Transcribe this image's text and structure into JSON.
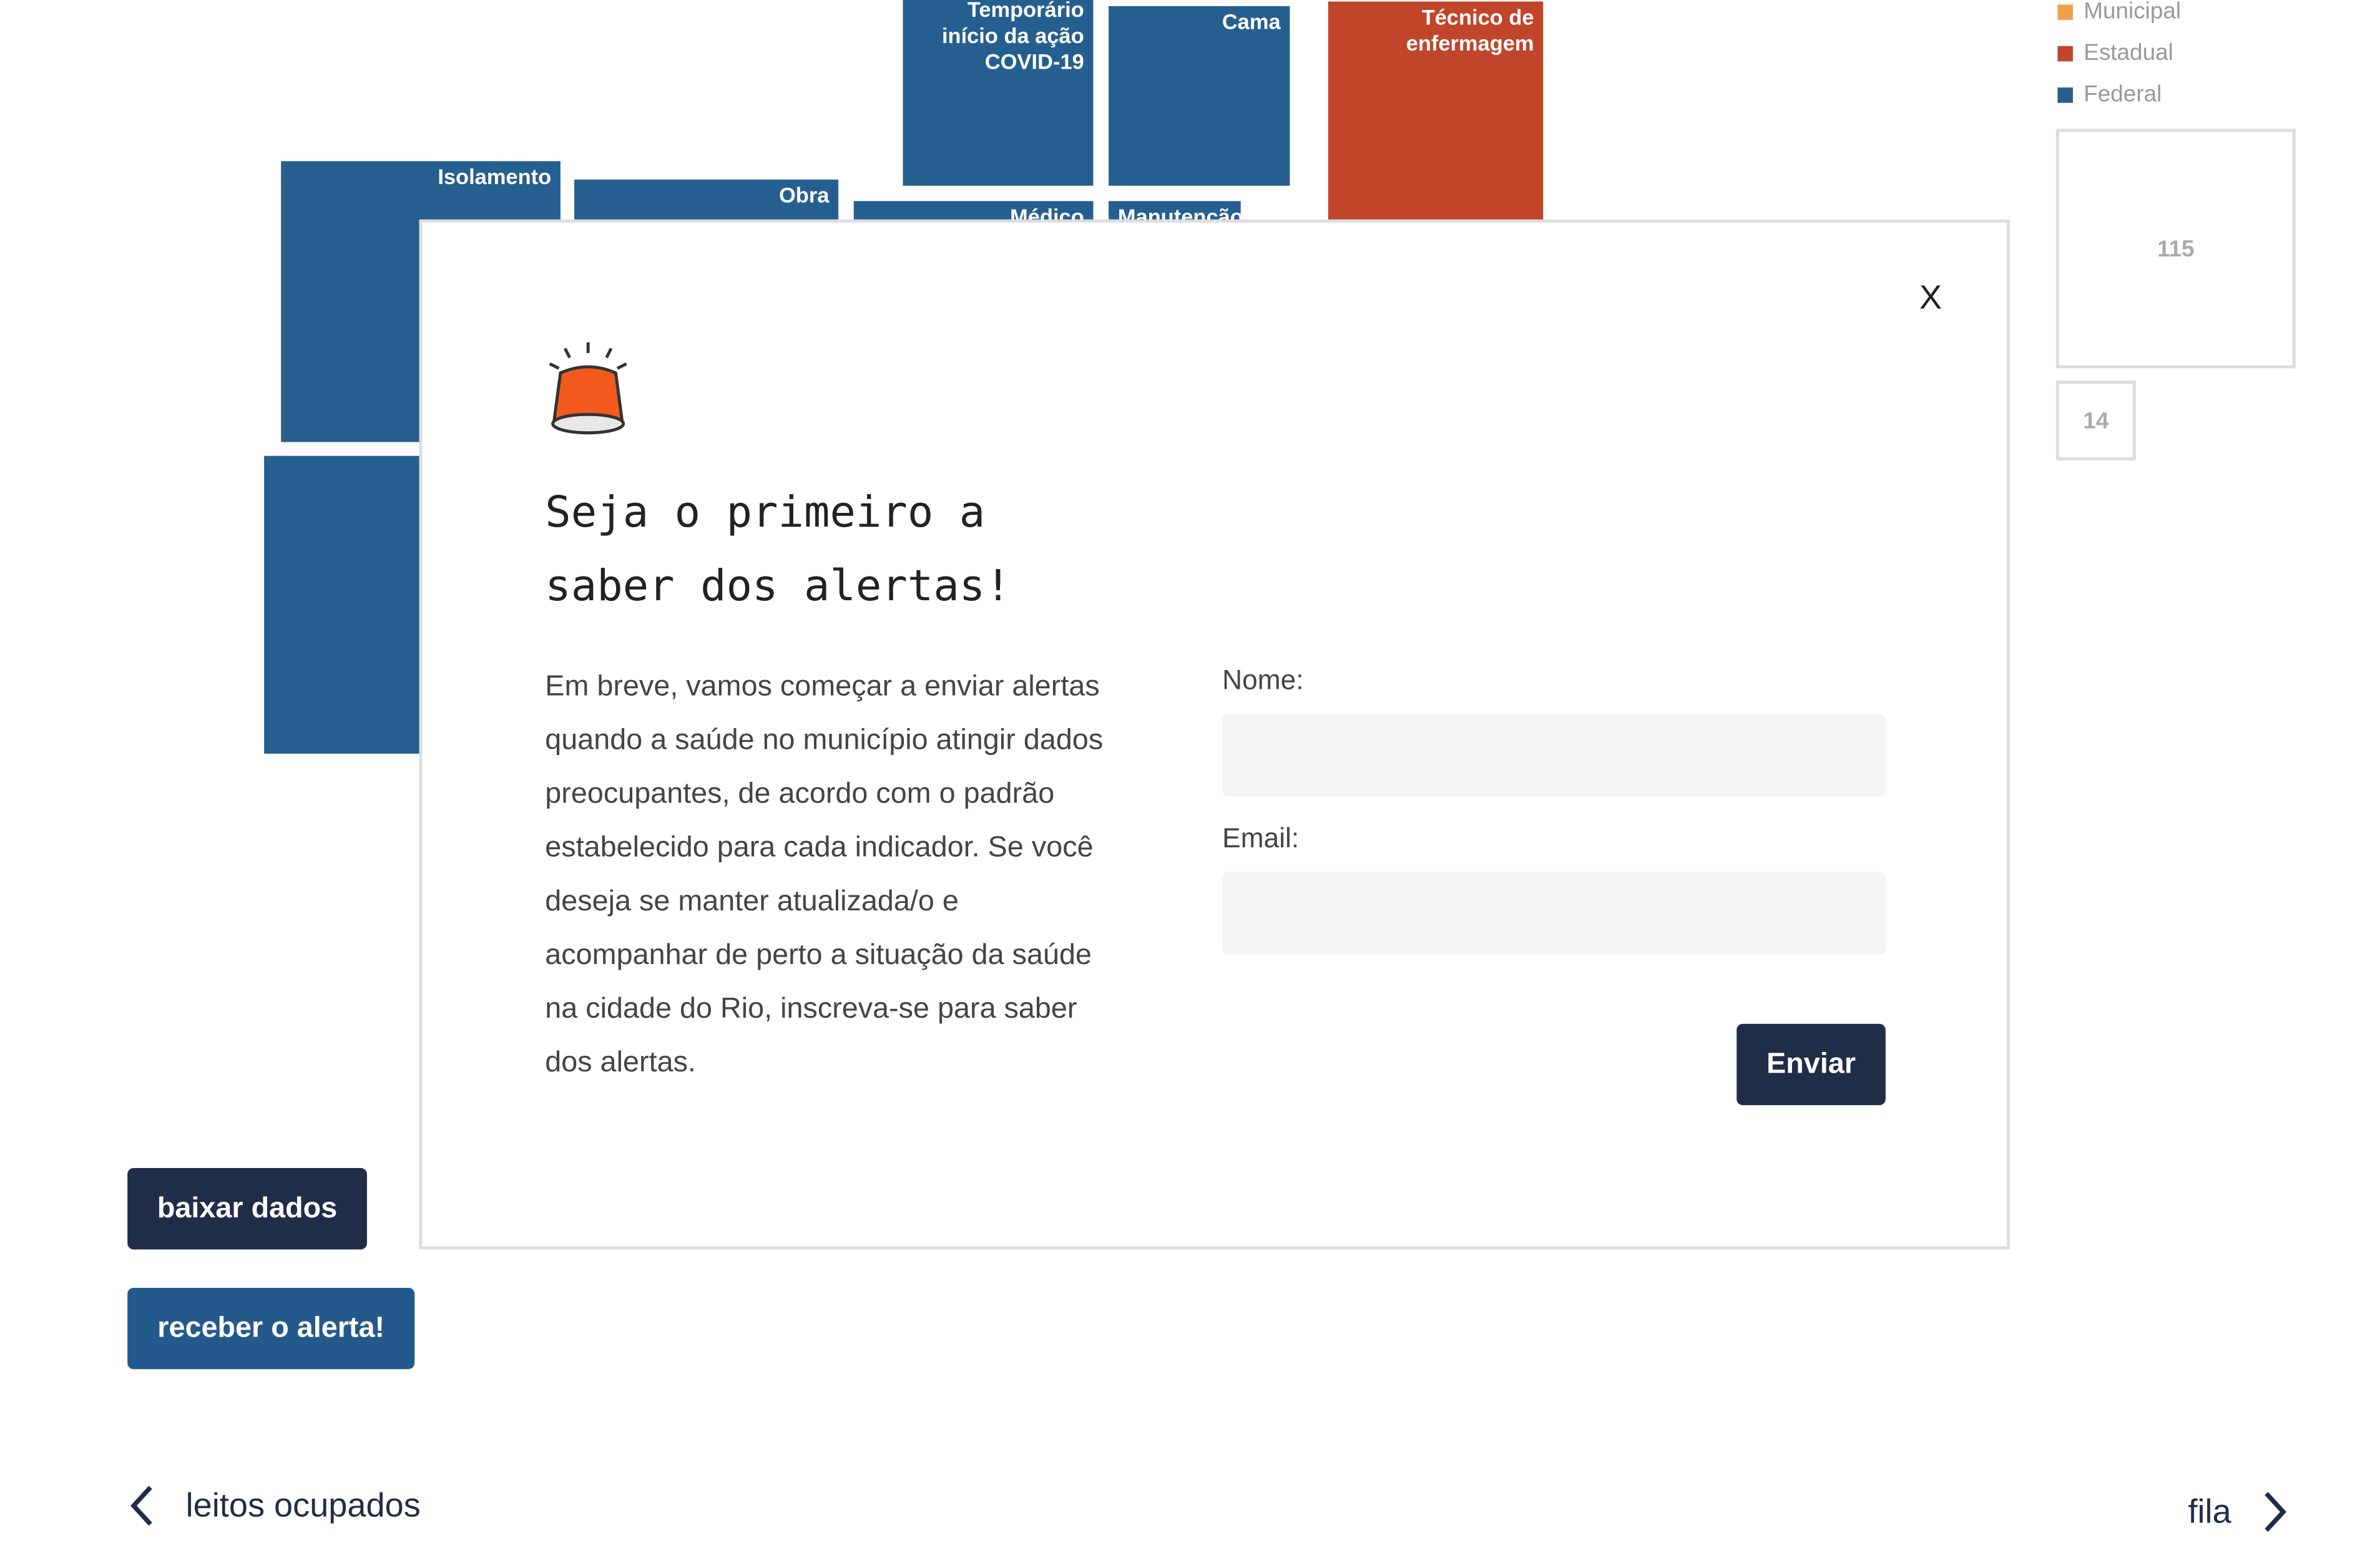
{
  "treemap": {
    "tiles": [
      {
        "label": "Temporário início da ação COVID-19"
      },
      {
        "label": "Cama"
      },
      {
        "label": "Técnico de enfermagem"
      },
      {
        "label": "Isolamento"
      },
      {
        "label": "Obra"
      },
      {
        "label": "Médico"
      },
      {
        "label": "Manutenção"
      }
    ]
  },
  "legend": {
    "items": [
      {
        "label": "Municipal",
        "color": "#f0a04b"
      },
      {
        "label": "Estadual",
        "color": "#c0452b"
      },
      {
        "label": "Federal",
        "color": "#255f8f"
      }
    ],
    "size_large": "115",
    "size_small": "14"
  },
  "actions": {
    "download_label": "baixar dados",
    "alert_label": "receber o alerta!"
  },
  "nav": {
    "prev_label": "leitos ocupados",
    "next_label": "fila"
  },
  "modal": {
    "close_label": "X",
    "title": "Seja o primeiro a saber dos alertas!",
    "description": "Em breve, vamos começar a enviar alertas quando a saúde no município atingir dados preocupantes, de acordo com o padrão estabelecido para cada indicador. Se você deseja se manter atualizada/o e acompanhar de perto a situação da saúde na cidade do Rio, inscreva-se para saber dos alertas.",
    "name_label": "Nome:",
    "name_value": "",
    "email_label": "Email:",
    "email_value": "",
    "submit_label": "Enviar",
    "alarm_icon": "siren-icon"
  }
}
